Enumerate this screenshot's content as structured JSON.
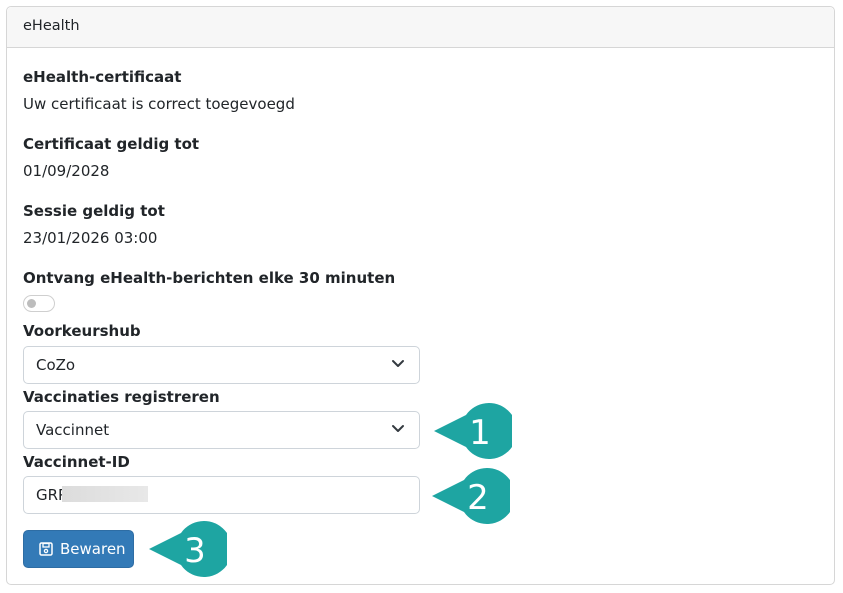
{
  "card": {
    "title": "eHealth"
  },
  "fields": {
    "certificate_label": "eHealth-certificaat",
    "certificate_value": "Uw certificaat is correct toegevoegd",
    "valid_until_label": "Certificaat geldig tot",
    "valid_until_value": "01/09/2028",
    "session_label": "Sessie geldig tot",
    "session_value": "23/01/2026 03:00",
    "receive_label": "Ontvang eHealth-berichten elke 30 minuten",
    "receive_enabled": false,
    "hub_label": "Voorkeurshub",
    "hub_value": "CoZo",
    "vacc_label": "Vaccinaties registreren",
    "vacc_value": "Vaccinnet",
    "vaccid_label": "Vaccinnet-ID",
    "vaccid_value": "GRP"
  },
  "actions": {
    "save_label": "Bewaren"
  },
  "callouts": [
    "1",
    "2",
    "3"
  ],
  "colors": {
    "callout": "#1ea5a2",
    "button": "#337ab7"
  }
}
